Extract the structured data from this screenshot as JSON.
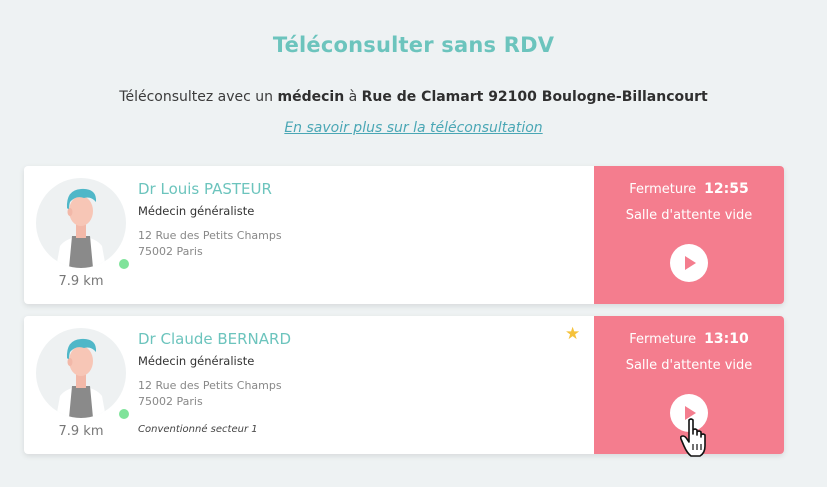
{
  "header": {
    "title": "Téléconsulter sans RDV",
    "subtitle_prefix": "Téléconsultez avec un ",
    "subtitle_bold1": "médecin",
    "subtitle_middle": " à ",
    "subtitle_bold2": "Rue de Clamart 92100 Boulogne-Billancourt",
    "learn_more": "En savoir plus sur la téléconsultation"
  },
  "doctors": [
    {
      "name": "Dr Louis PASTEUR",
      "specialty": "Médecin généraliste",
      "address_line1": "12 Rue des Petits Champs",
      "address_line2": "75002 Paris",
      "distance": "7.9 km",
      "closing_label": "Fermeture",
      "closing_time": "12:55",
      "status": "Salle d'attente vide",
      "online": true,
      "favorite": false
    },
    {
      "name": "Dr Claude BERNARD",
      "specialty": "Médecin généraliste",
      "address_line1": "12 Rue des Petits Champs",
      "address_line2": "75002 Paris",
      "distance": "7.9 km",
      "convention": "Conventionné secteur 1",
      "closing_label": "Fermeture",
      "closing_time": "13:10",
      "status": "Salle d'attente vide",
      "online": true,
      "favorite": true
    }
  ],
  "colors": {
    "accent": "#6cc4bd",
    "action": "#f47d8e",
    "online": "#7fe39a",
    "star": "#f5c23b",
    "link": "#4aa7b5"
  },
  "icons": {
    "play": "play-icon",
    "star": "star-icon",
    "cursor": "hand-pointer-icon"
  }
}
